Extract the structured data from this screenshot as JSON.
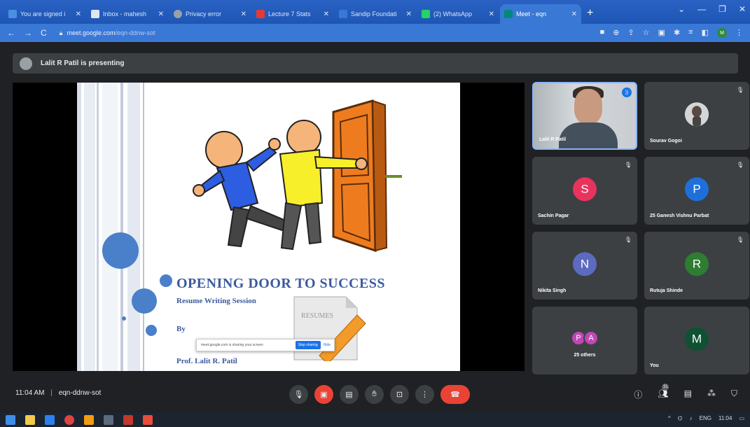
{
  "browser": {
    "tabs": [
      {
        "label": "You are signed i",
        "color": "#4a90e2"
      },
      {
        "label": "Inbox - mahesh",
        "color": "#e0e6f0"
      },
      {
        "label": "Privacy error",
        "color": "#9aa0a6"
      },
      {
        "label": "Lecture 7 Stats",
        "color": "#e53935"
      },
      {
        "label": "Sandip Foundati",
        "color": "#3a78d6"
      },
      {
        "label": "(2) WhatsApp",
        "color": "#25d366"
      },
      {
        "label": "Meet - eqn",
        "color": "#00897b"
      }
    ],
    "new_tab": "+",
    "url_host": "meet.google.com",
    "url_path": "/eqn-ddnw-sot",
    "profile_initial": "M"
  },
  "presenting": {
    "text": "Lalit R Patil is presenting"
  },
  "slide": {
    "title": "OPENING DOOR TO SUCCESS",
    "subtitle": "Resume Writing Session",
    "by": "By",
    "author": "Prof. Lalit R. Patil",
    "resumes_label": "RESUMES",
    "share_message": "meet.google.com is sharing your screen",
    "stop_sharing": "Stop sharing",
    "hide": "Hide"
  },
  "participants": [
    {
      "name": "Lalit R Patil",
      "type": "camera"
    },
    {
      "name": "Sourav Gogoi",
      "type": "photo"
    },
    {
      "name": "Sachin Pagar",
      "initial": "S",
      "color": "#e8335d"
    },
    {
      "name": "25 Ganesh Vishnu Parbat",
      "initial": "P",
      "color": "#1e6fd9"
    },
    {
      "name": "Nikita Singh",
      "initial": "N",
      "color": "#5c6bc0"
    },
    {
      "name": "Rutuja Shinde",
      "initial": "R",
      "color": "#2e7d32"
    },
    {
      "name": "25 others",
      "initials": [
        "P",
        "A"
      ]
    },
    {
      "name": "You",
      "initial": "M",
      "color": "#0f5132"
    }
  ],
  "bottom": {
    "time": "11:04 AM",
    "separator": "|",
    "meeting_code": "eqn-ddnw-sot",
    "people_count": "31"
  },
  "taskbar": {
    "lang": "ENG",
    "clock": "11:04"
  }
}
